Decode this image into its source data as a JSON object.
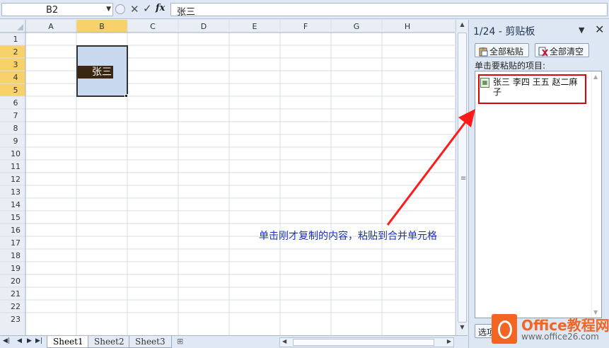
{
  "formula_bar": {
    "name_box": "B2",
    "fx_label": "fx",
    "formula": "张三"
  },
  "grid": {
    "columns": [
      "A",
      "B",
      "C",
      "D",
      "E",
      "F",
      "G",
      "H"
    ],
    "rows": [
      "1",
      "2",
      "3",
      "4",
      "5",
      "6",
      "7",
      "8",
      "9",
      "10",
      "11",
      "12",
      "13",
      "14",
      "15",
      "16",
      "17",
      "18",
      "19",
      "20",
      "21",
      "22",
      "23"
    ],
    "selected_column": "B",
    "selected_rows": [
      "2",
      "3",
      "4",
      "5"
    ],
    "merged_cell_text": "张三"
  },
  "sheets": {
    "tabs": [
      "Sheet1",
      "Sheet2",
      "Sheet3"
    ],
    "active": "Sheet1"
  },
  "clipboard_pane": {
    "title": "1/24 - 剪贴板",
    "paste_all": "全部粘贴",
    "clear_all": "全部清空",
    "label": "单击要粘贴的项目:",
    "items": [
      "张三 李四 王五 赵二麻子"
    ],
    "options": "选项"
  },
  "annotation": {
    "text": "单击刚才复制的内容，粘贴到合并单元格",
    "color": "#1a2fc4",
    "arrow_color": "#ff1a1a"
  },
  "logo": {
    "name": "Office教程网",
    "url": "www.office26.com"
  },
  "colors": {
    "selection_fill": "#c8d9ef",
    "header_highlight": "#f7d26a",
    "highlight_box": "#e00000"
  }
}
